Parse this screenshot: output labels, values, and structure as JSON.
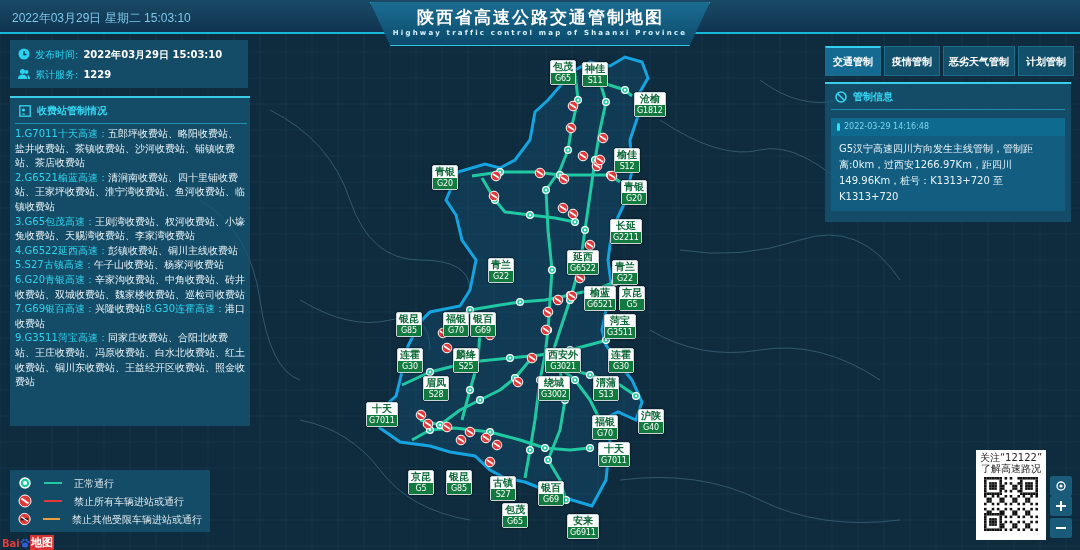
{
  "header": {
    "datetime": "2022年03月29日 星期二  15:03:10",
    "title": "陕西省高速公路交通管制地图",
    "subtitle": "Highway traffic control map of Shaanxi Province"
  },
  "info": [
    {
      "kind": "clock",
      "label": "发布时间:",
      "value": "2022年03月29日  15:03:10"
    },
    {
      "kind": "users",
      "label": "累计服务:",
      "value": "1229"
    }
  ],
  "toll_panel": {
    "title": "收费站管制情况",
    "lines": [
      [
        {
          "road": "1.G7011十天高速：",
          "stations": "五郎坪收费站、略阳收费站、盐井收费站、茶镇收费站、沙河收费站、铺镇收费站、茶店收费站"
        }
      ],
      [
        {
          "road": "2.G6521榆蓝高速：",
          "stations": "清涧南收费站、四十里铺收费站、王家坪收费站、淮宁湾收费站、鱼河收费站、临镇收费站"
        }
      ],
      [
        {
          "road": "3.G65包茂高速：",
          "stations": "王则湾收费站、杈河收费站、小壕兔收费站、天赐湾收费站、李家湾收费站"
        }
      ],
      [
        {
          "road": "4.G6522延西高速：",
          "stations": "彭镇收费站、铜川主线收费站"
        }
      ],
      [
        {
          "road": "5.S27古镇高速：",
          "stations": "午子山收费站、杨家河收费站"
        }
      ],
      [
        {
          "road": "6.G20青银高速：",
          "stations": "辛家沟收费站、中角收费站、砖井收费站、双城收费站、魏家楼收费站、巡检司收费站"
        }
      ],
      [
        {
          "road": "7.G69银百高速：",
          "stations": "兴隆收费站"
        },
        {
          "road": "8.G30连霍高速：",
          "stations": "港口收费站"
        }
      ],
      [
        {
          "road": "9.G3511菏宝高速：",
          "stations": "同家庄收费站、合阳北收费站、王庄收费站、冯原收费站、白水北收费站、红土收费站、铜川东收费站、王益经开区收费站、照金收费站"
        }
      ]
    ]
  },
  "tabs": [
    {
      "label": "交通管制",
      "selected": true
    },
    {
      "label": "疫情管制",
      "selected": false
    },
    {
      "label": "恶劣天气管制",
      "selected": false
    },
    {
      "label": "计划管制",
      "selected": false
    }
  ],
  "control_panel": {
    "title": "管制信息",
    "entries": [
      {
        "time": "2022-03-29 14:16:48",
        "text": "G5汉宁高速四川方向发生主线管制，管制距离:0km，过西安1266.97Km，距四川149.96Km，桩号：K1313+720 至 K1313+720"
      }
    ]
  },
  "map": {
    "shields": [
      {
        "name": "包茂",
        "code": "G65"
      },
      {
        "name": "神佳",
        "code": "S11"
      },
      {
        "name": "沧榆",
        "code": "G1812"
      },
      {
        "name": "青银",
        "code": "G20"
      },
      {
        "name": "榆佳",
        "code": "S12"
      },
      {
        "name": "青银",
        "code": "G20"
      },
      {
        "name": "长延",
        "code": "G2211"
      },
      {
        "name": "青兰",
        "code": "G22"
      },
      {
        "name": "延西",
        "code": "G6522"
      },
      {
        "name": "青兰",
        "code": "G22"
      },
      {
        "name": "榆蓝",
        "code": "G6521"
      },
      {
        "name": "京昆",
        "code": "G5"
      },
      {
        "name": "银昆",
        "code": "G85"
      },
      {
        "name": "福银",
        "code": "G70"
      },
      {
        "name": "银百",
        "code": "G69"
      },
      {
        "name": "菏宝",
        "code": "G3511"
      },
      {
        "name": "连霍",
        "code": "G30"
      },
      {
        "name": "麟绛",
        "code": "S25"
      },
      {
        "name": "西安外",
        "code": "G3021"
      },
      {
        "name": "连霍",
        "code": "G30"
      },
      {
        "name": "眉凤",
        "code": "S28"
      },
      {
        "name": "绕城",
        "code": "G3002"
      },
      {
        "name": "渭蒲",
        "code": "S13"
      },
      {
        "name": "十天",
        "code": "G7011"
      },
      {
        "name": "福银",
        "code": "G70"
      },
      {
        "name": "沪陕",
        "code": "G40"
      },
      {
        "name": "十天",
        "code": "G7011"
      },
      {
        "name": "京昆",
        "code": "G5"
      },
      {
        "name": "银昆",
        "code": "G85"
      },
      {
        "name": "古镇",
        "code": "S27"
      },
      {
        "name": "包茂",
        "code": "G65"
      },
      {
        "name": "银百",
        "code": "G69"
      },
      {
        "name": "安来",
        "code": "G6911"
      }
    ],
    "logo_text": "Bai",
    "logo_suffix": "地图",
    "controls": [
      {
        "kind": "locate"
      },
      {
        "kind": "zoom_in"
      },
      {
        "kind": "zoom_out"
      }
    ]
  },
  "legend": [
    {
      "kind": "normal",
      "color": "#21c9a3",
      "label": "正常通行"
    },
    {
      "kind": "closed",
      "color": "#e03a3a",
      "label": "禁止所有车辆进站或通行"
    },
    {
      "kind": "restricted",
      "color": "#e8a040",
      "label": "禁止其他受限车辆进站或通行"
    }
  ],
  "qr": {
    "caption_1": "关注“12122”",
    "caption_2": "了解高速路况"
  }
}
